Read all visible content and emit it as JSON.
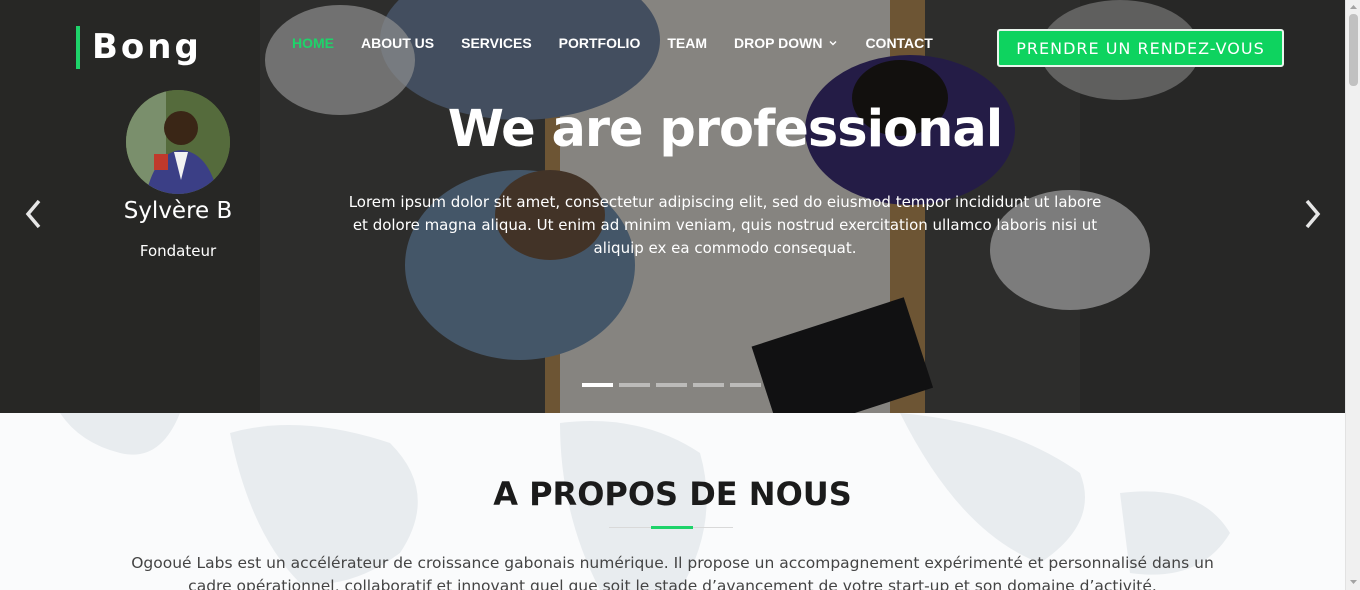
{
  "brand": {
    "name": "Bong"
  },
  "nav": {
    "items": [
      {
        "label": "HOME",
        "active": true
      },
      {
        "label": "ABOUT US"
      },
      {
        "label": "SERVICES"
      },
      {
        "label": "PORTFOLIO"
      },
      {
        "label": "TEAM"
      },
      {
        "label": "DROP DOWN",
        "has_dropdown": true
      },
      {
        "label": "CONTACT"
      }
    ],
    "cta_label": "PRENDRE UN RENDEZ-VOUS"
  },
  "hero": {
    "profile": {
      "name": "Sylvère B",
      "role": "Fondateur"
    },
    "title": "We are professional",
    "text": "Lorem ipsum dolor sit amet, consectetur adipiscing elit, sed do eiusmod tempor incididunt ut labore et dolore magna aliqua. Ut enim ad minim veniam, quis nostrud exercitation ullamco laboris nisi ut aliquip ex ea commodo consequat.",
    "slides_total": 5,
    "active_slide": 1
  },
  "about": {
    "title": "A PROPOS DE NOUS",
    "text": "Ogooué Labs est un accélérateur de croissance gabonais numérique. Il propose un accompagnement expérimenté et personnalisé dans un cadre opérationnel, collaboratif et innovant quel que soit le stade d’avancement de votre start-up et son domaine d’activité."
  },
  "colors": {
    "accent": "#1ed36a",
    "cta": "#0ed35f"
  },
  "icons": {
    "prev": "chevron-left-icon",
    "next": "chevron-right-icon",
    "dropdown": "chevron-down-icon"
  }
}
